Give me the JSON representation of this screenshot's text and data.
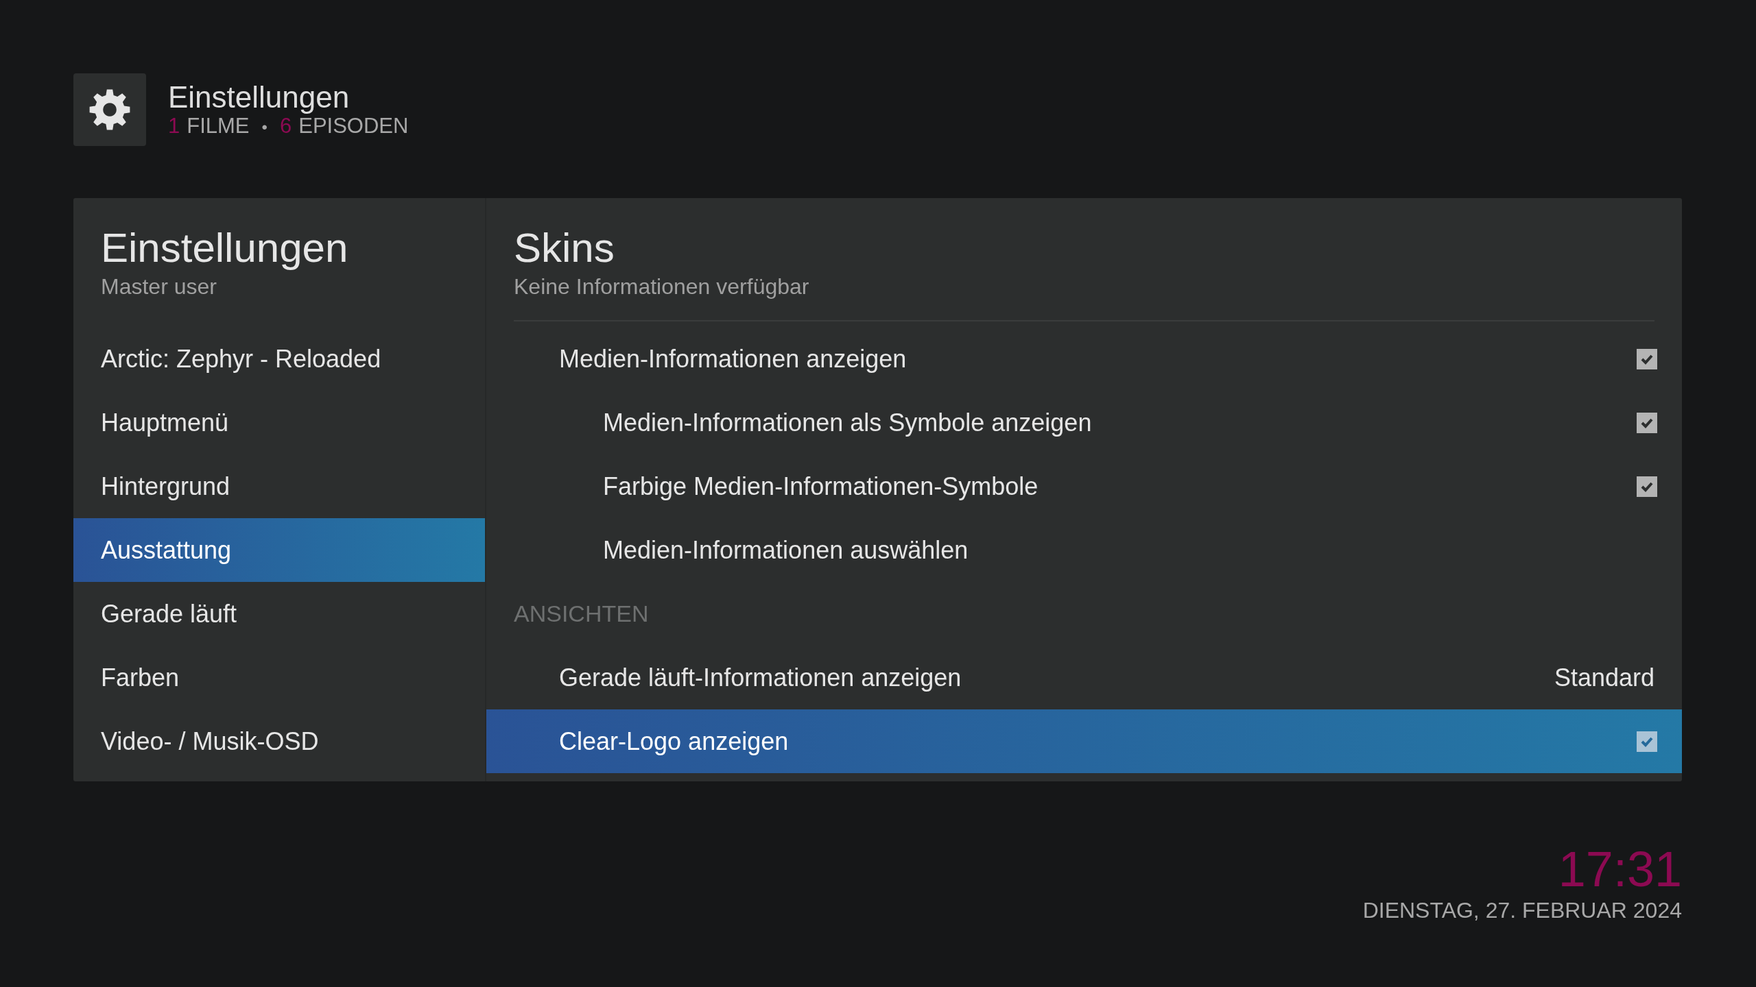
{
  "header": {
    "title": "Einstellungen",
    "stats": [
      {
        "count": "1",
        "label": "FILME"
      },
      {
        "count": "6",
        "label": "EPISODEN"
      }
    ],
    "separator": "•"
  },
  "sidebar": {
    "title": "Einstellungen",
    "subtitle": "Master user",
    "items": [
      {
        "label": "Arctic: Zephyr - Reloaded",
        "selected": false
      },
      {
        "label": "Hauptmenü",
        "selected": false
      },
      {
        "label": "Hintergrund",
        "selected": false
      },
      {
        "label": "Ausstattung",
        "selected": true
      },
      {
        "label": "Gerade läuft",
        "selected": false
      },
      {
        "label": "Farben",
        "selected": false
      },
      {
        "label": "Video- / Musik-OSD",
        "selected": false
      }
    ]
  },
  "content": {
    "title": "Skins",
    "subtitle": "Keine Informationen verfügbar",
    "settings": [
      {
        "kind": "checkbox",
        "label": "Medien-Informationen anzeigen",
        "checked": true,
        "selected": false,
        "children": [
          {
            "kind": "checkbox",
            "label": "Medien-Informationen als Symbole anzeigen",
            "checked": true,
            "selected": false
          },
          {
            "kind": "checkbox",
            "label": "Farbige Medien-Informationen-Symbole",
            "checked": true,
            "selected": false
          },
          {
            "kind": "action",
            "label": "Medien-Informationen auswählen",
            "selected": false
          }
        ]
      },
      {
        "kind": "header",
        "label": "ANSICHTEN"
      },
      {
        "kind": "value",
        "label": "Gerade läuft-Informationen anzeigen",
        "value": "Standard",
        "selected": false
      },
      {
        "kind": "checkbox",
        "label": "Clear-Logo anzeigen",
        "checked": true,
        "selected": true
      }
    ]
  },
  "clock": {
    "time": "17:31",
    "date": "DIENSTAG, 27. FEBRUAR 2024"
  }
}
